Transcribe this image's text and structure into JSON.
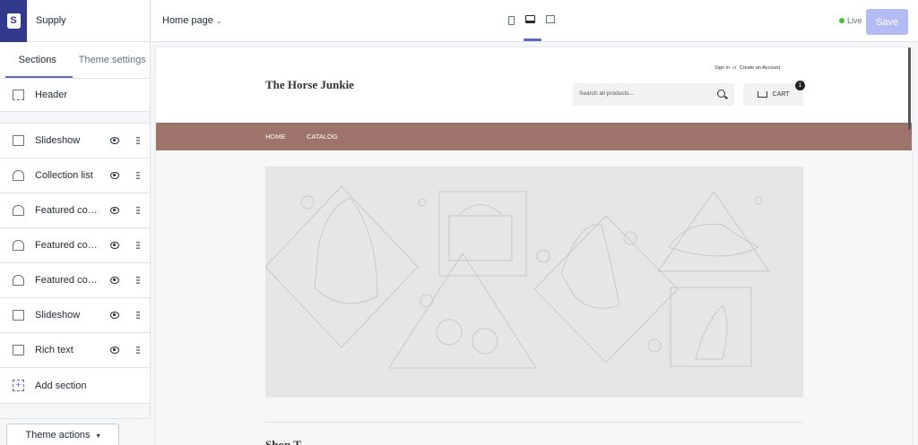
{
  "app": {
    "store_name": "Supply",
    "logo_letter": "S"
  },
  "sidebar": {
    "tabs": [
      {
        "label": "Sections"
      },
      {
        "label": "Theme settings"
      }
    ],
    "header": {
      "label": "Header"
    },
    "sections": [
      {
        "label": "Slideshow",
        "icon": "slideshow-icon"
      },
      {
        "label": "Collection list",
        "icon": "collection-icon"
      },
      {
        "label": "Featured colle...",
        "icon": "collection-icon"
      },
      {
        "label": "Featured colle...",
        "icon": "collection-icon"
      },
      {
        "label": "Featured colle...",
        "icon": "collection-icon"
      },
      {
        "label": "Slideshow",
        "icon": "slideshow-icon"
      },
      {
        "label": "Rich text",
        "icon": "text-icon"
      }
    ],
    "add_section": {
      "label": "Add section",
      "icon_glyph": "+"
    },
    "theme_actions": {
      "label": "Theme actions",
      "caret": "▾"
    }
  },
  "topbar": {
    "page_select": "Home page",
    "page_chevron": "⌄",
    "live_label": "Live",
    "save_label": "Save",
    "accent_color": "#5c6ac4",
    "live_color": "#50b83c"
  },
  "preview": {
    "store_title": "The Horse Junkie",
    "sign_in": "Sign in",
    "or": "or",
    "create_account": "Create an Account",
    "search_placeholder": "Search all products...",
    "cart_label": "CART",
    "cart_count": "1",
    "nav": [
      {
        "label": "HOME"
      },
      {
        "label": "CATALOG"
      }
    ],
    "nav_color": "#9e736b",
    "next_title": "Shop T"
  }
}
